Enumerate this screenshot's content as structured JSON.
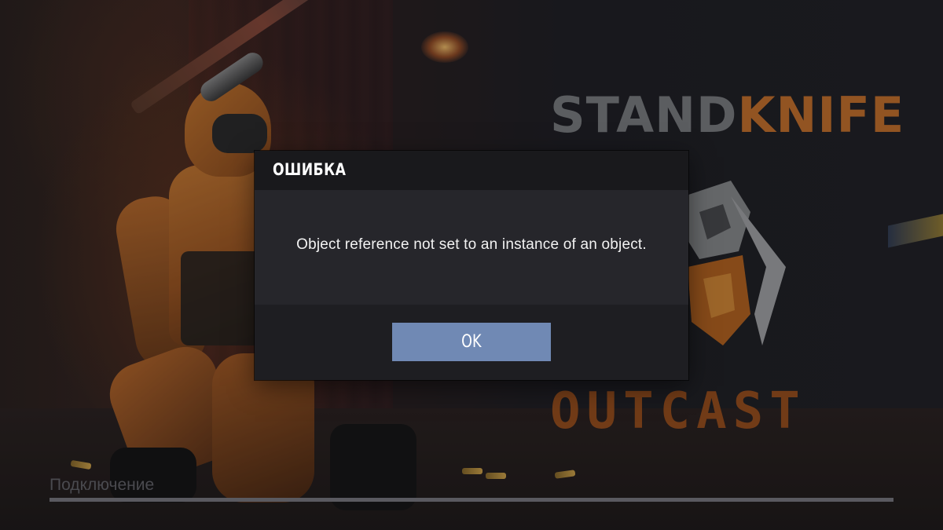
{
  "background": {
    "logo": {
      "part1": "STAND",
      "part2": "KNIFE"
    },
    "subtitle": "OUTCAST"
  },
  "loading": {
    "status_text": "Подключение",
    "progress": 1.0
  },
  "dialog": {
    "title": "ОШИБКА",
    "message": "Object reference not set to an instance of an object.",
    "ok_label": "OK"
  },
  "colors": {
    "button_bg": "#7089b4",
    "dialog_body": "#26262b",
    "dialog_header": "#19191c",
    "logo_knife": "#c8722c",
    "logo_stand": "#7c7f82"
  }
}
